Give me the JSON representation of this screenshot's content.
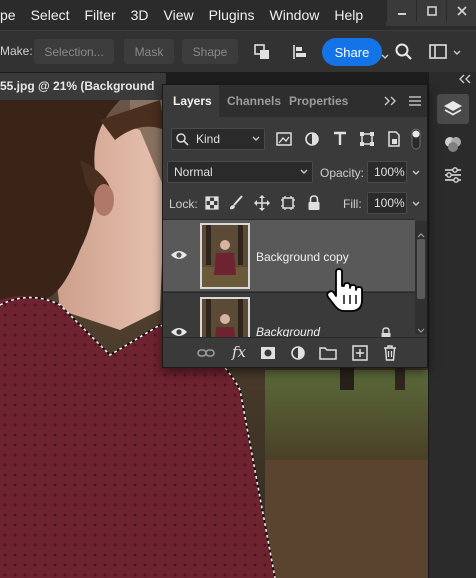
{
  "menu": [
    "pe",
    "Select",
    "Filter",
    "3D",
    "View",
    "Plugins",
    "Window",
    "Help"
  ],
  "options": {
    "make_label": "Make:",
    "selection_label": "Selection...",
    "mask_label": "Mask",
    "shape_label": "Shape",
    "share_label": "Share"
  },
  "document": {
    "tab_title": "55.jpg @ 21% (Background"
  },
  "layers_panel": {
    "tabs": [
      "Layers",
      "Channels",
      "Properties"
    ],
    "filter_value": "Kind",
    "blend_mode": "Normal",
    "opacity_label": "Opacity:",
    "opacity_value": "100%",
    "lock_label": "Lock:",
    "fill_label": "Fill:",
    "fill_value": "100%",
    "layers": [
      {
        "name": "Background copy",
        "selected": true,
        "visible": true,
        "locked": false
      },
      {
        "name": "Background",
        "selected": false,
        "visible": true,
        "locked": true
      }
    ]
  },
  "colors": {
    "accent": "#1473e6",
    "panel_bg": "#3a3a3a",
    "selected_layer": "#595959",
    "sweater": "#6e2330"
  }
}
